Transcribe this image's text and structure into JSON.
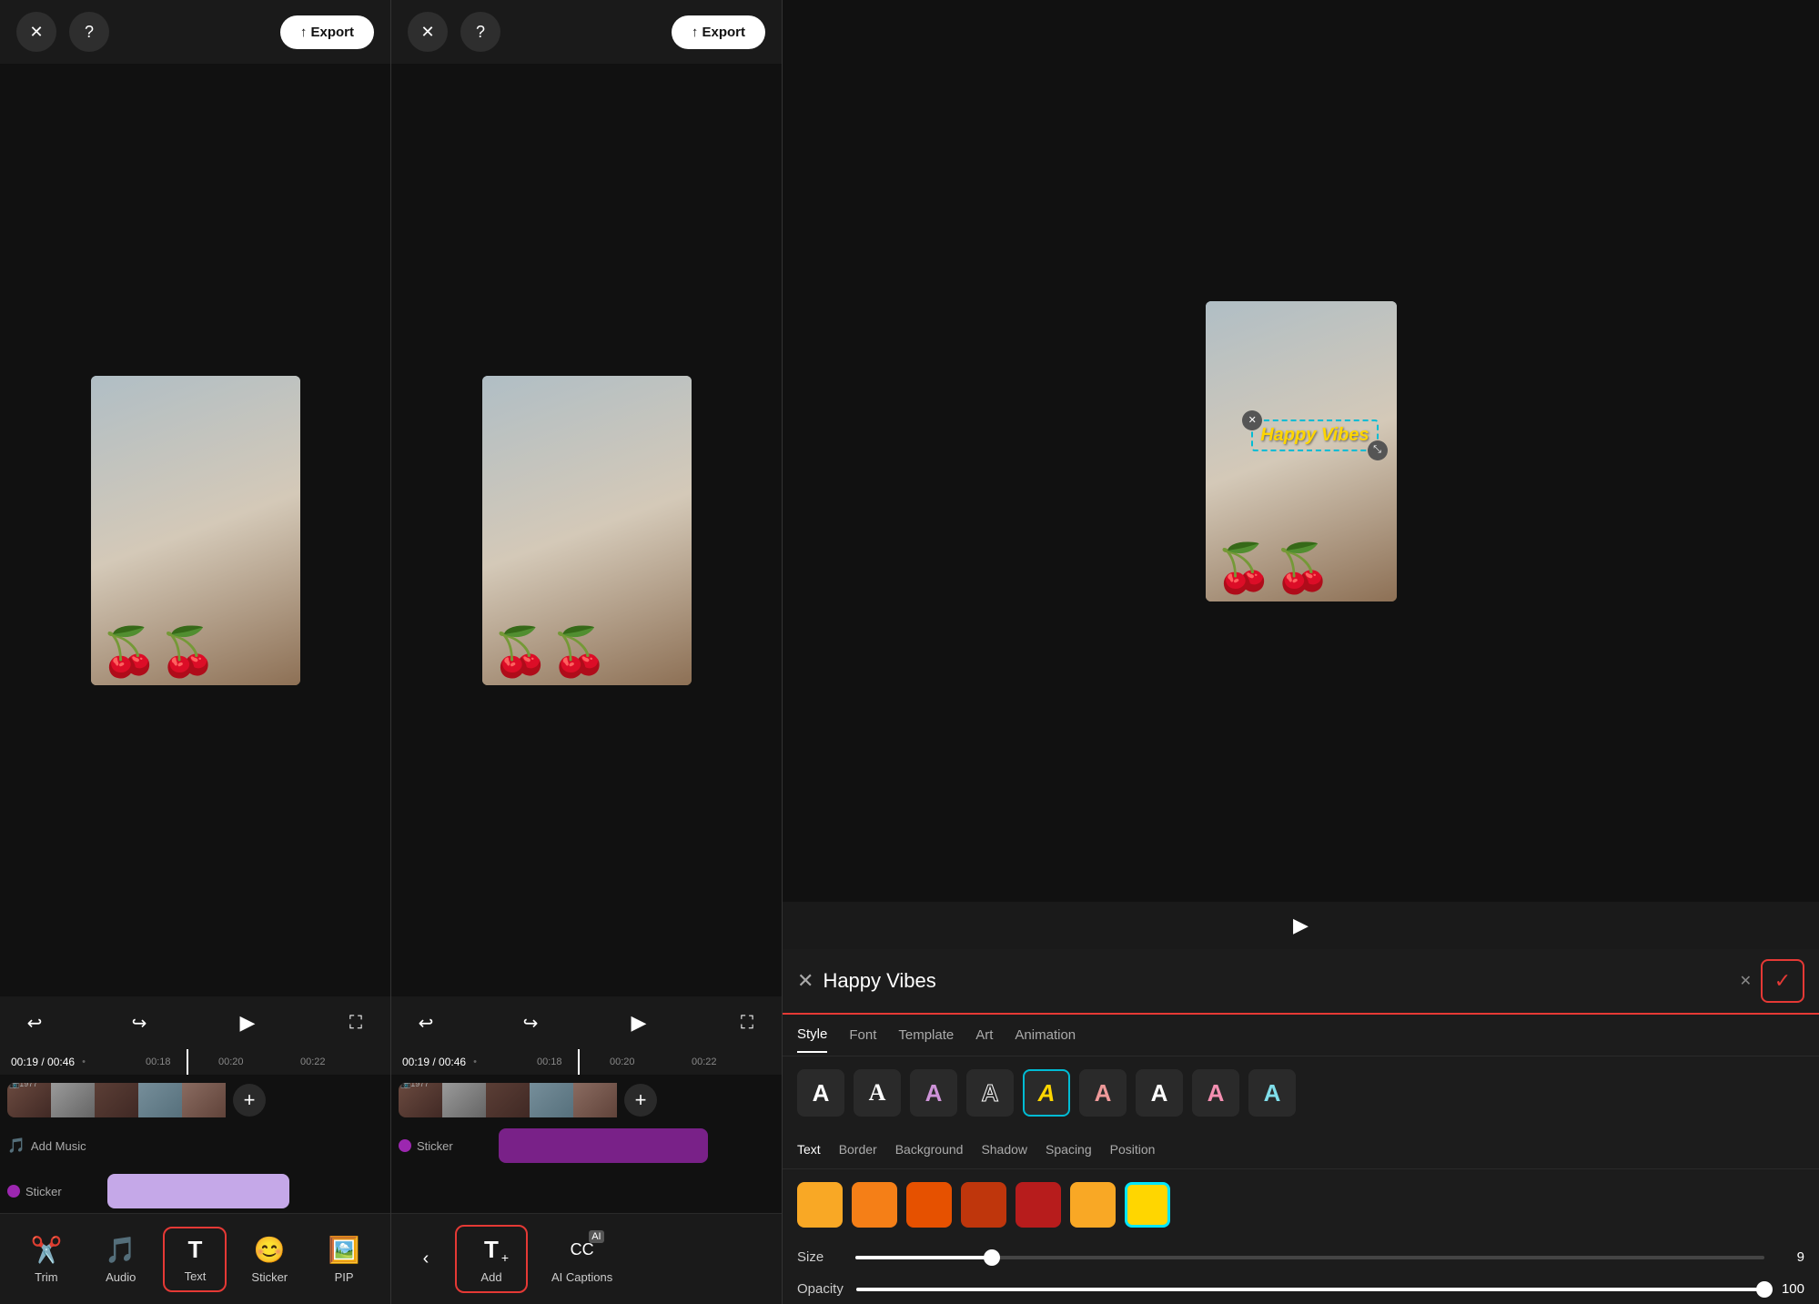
{
  "panels": {
    "left": {
      "close_label": "✕",
      "help_label": "?",
      "export_label": "↑ Export",
      "time_display": "00:19 / 00:46",
      "ruler_marks": [
        "00:18",
        "00:20",
        "00:22"
      ],
      "add_music_label": "Add Music",
      "sticker_label": "Sticker",
      "tools": [
        {
          "id": "trim",
          "label": "Trim",
          "icon": "✂"
        },
        {
          "id": "audio",
          "label": "Audio",
          "icon": "♪"
        },
        {
          "id": "text",
          "label": "Text",
          "icon": "T",
          "active": true
        },
        {
          "id": "sticker",
          "label": "Sticker",
          "icon": "●"
        },
        {
          "id": "pip",
          "label": "PIP",
          "icon": "▦"
        }
      ]
    },
    "mid": {
      "close_label": "✕",
      "help_label": "?",
      "export_label": "↑ Export",
      "time_display": "00:19 / 00:46",
      "sticker_label": "Sticker",
      "mid_tools": [
        {
          "id": "add",
          "label": "Add",
          "icon": "T+",
          "active": true
        },
        {
          "id": "ai_captions",
          "label": "AI Captions",
          "icon": "CC"
        }
      ]
    },
    "right": {
      "text_value": "Happy Vibes",
      "confirm_icon": "✓",
      "close_icon": "✕",
      "style_tabs": [
        {
          "id": "style",
          "label": "Style",
          "active": true
        },
        {
          "id": "font",
          "label": "Font"
        },
        {
          "id": "template",
          "label": "Template"
        },
        {
          "id": "art",
          "label": "Art"
        },
        {
          "id": "animation",
          "label": "Animation"
        }
      ],
      "font_styles": [
        {
          "id": "plain",
          "char": "A",
          "color": "#fff"
        },
        {
          "id": "serif",
          "char": "A",
          "color": "#fff"
        },
        {
          "id": "purple",
          "char": "A",
          "color": "#ce93d8"
        },
        {
          "id": "outline",
          "char": "A",
          "color": "#fff"
        },
        {
          "id": "gold-outline",
          "char": "A",
          "color": "#ffd600",
          "selected": true
        },
        {
          "id": "gradient",
          "char": "A",
          "color": "#ef9a9a"
        },
        {
          "id": "bold-dark",
          "char": "A",
          "color": "#fff"
        },
        {
          "id": "pink",
          "char": "A",
          "color": "#f48fb1"
        },
        {
          "id": "cyan",
          "char": "A",
          "color": "#80deea"
        }
      ],
      "text_prop_tabs": [
        {
          "id": "text",
          "label": "Text",
          "active": true
        },
        {
          "id": "border",
          "label": "Border"
        },
        {
          "id": "background",
          "label": "Background"
        },
        {
          "id": "shadow",
          "label": "Shadow"
        },
        {
          "id": "spacing",
          "label": "Spacing"
        },
        {
          "id": "position",
          "label": "Position"
        }
      ],
      "colors": [
        {
          "hex": "#f9a825"
        },
        {
          "hex": "#f57f17"
        },
        {
          "hex": "#e65100"
        },
        {
          "hex": "#bf360c"
        },
        {
          "hex": "#b71c1c"
        },
        {
          "hex": "#f9a825"
        },
        {
          "hex": "#ffd600",
          "selected": true
        }
      ],
      "size_label": "Size",
      "size_value": "9",
      "size_percent": 15,
      "opacity_label": "Opacity",
      "opacity_value": "100",
      "opacity_percent": 100,
      "video_text_overlay": "Happy Vibes"
    }
  }
}
